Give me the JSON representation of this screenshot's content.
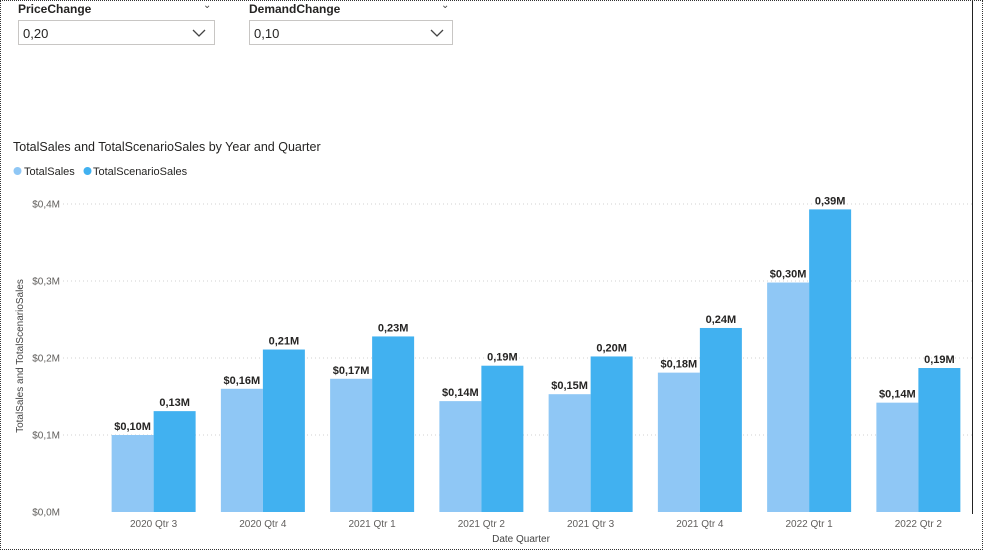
{
  "slicers": [
    {
      "title": "PriceChange",
      "value": "0,20"
    },
    {
      "title": "DemandChange",
      "value": "0,10"
    }
  ],
  "colors": {
    "series1": "#8fc7f5",
    "series2": "#41b1f0",
    "grid": "#d0d0d0"
  },
  "chart_data": {
    "type": "bar",
    "title": "TotalSales and TotalScenarioSales by Year and Quarter",
    "xlabel": "Date Quarter",
    "ylabel": "TotalSales and TotalScenarioSales",
    "categories": [
      "2020 Qtr 3",
      "2020 Qtr 4",
      "2021 Qtr 1",
      "2021 Qtr 2",
      "2021 Qtr 3",
      "2021 Qtr 4",
      "2022 Qtr 1",
      "2022 Qtr 2"
    ],
    "series": [
      {
        "name": "TotalSales",
        "values": [
          0.1,
          0.16,
          0.173,
          0.144,
          0.153,
          0.181,
          0.298,
          0.142
        ],
        "labels": [
          "$0,10M",
          "$0,16M",
          "$0,17M",
          "$0,14M",
          "$0,15M",
          "$0,18M",
          "$0,30M",
          "$0,14M"
        ]
      },
      {
        "name": "TotalScenarioSales",
        "values": [
          0.131,
          0.211,
          0.228,
          0.19,
          0.202,
          0.239,
          0.393,
          0.187
        ],
        "labels": [
          "0,13M",
          "0,21M",
          "0,23M",
          "0,19M",
          "0,20M",
          "0,24M",
          "0,39M",
          "0,19M"
        ]
      }
    ],
    "yticks": [
      0,
      0.1,
      0.2,
      0.3,
      0.4
    ],
    "ytick_labels": [
      "$0,0M",
      "$0,1M",
      "$0,2M",
      "$0,3M",
      "$0,4M"
    ],
    "ylim": [
      0,
      0.4
    ],
    "grid": true,
    "legend": "top-left"
  }
}
